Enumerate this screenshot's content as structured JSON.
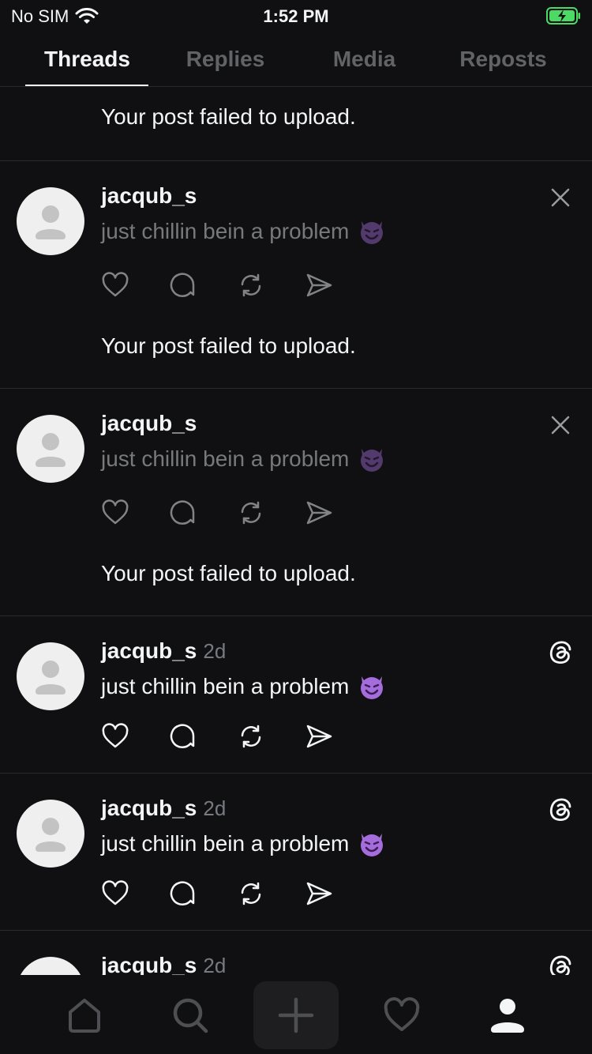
{
  "status_bar": {
    "carrier": "No SIM",
    "time": "1:52 PM"
  },
  "tabs": [
    {
      "label": "Threads",
      "active": true
    },
    {
      "label": "Replies",
      "active": false
    },
    {
      "label": "Media",
      "active": false
    },
    {
      "label": "Reposts",
      "active": false
    }
  ],
  "feed": {
    "top_partial_fail": "Your post failed to upload.",
    "posts": [
      {
        "username": "jacqub_s",
        "caption": "just chillin bein a problem",
        "fail": "Your post failed to upload."
      },
      {
        "username": "jacqub_s",
        "caption": "just chillin bein a problem",
        "fail": "Your post failed to upload."
      },
      {
        "username": "jacqub_s",
        "time": "2d",
        "caption": "just chillin bein a problem"
      },
      {
        "username": "jacqub_s",
        "time": "2d",
        "caption": "just chillin bein a problem"
      },
      {
        "username": "jacqub_s",
        "time": "2d"
      }
    ]
  },
  "colors": {
    "background": "#101012",
    "text": "#f3f5f7",
    "muted": "#616367",
    "divider": "#2a2a2d",
    "battery": "#4cd964"
  }
}
